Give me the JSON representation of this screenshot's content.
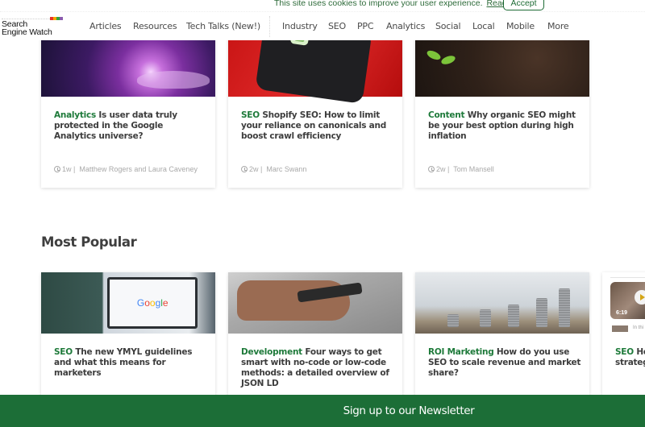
{
  "cookie_bar": {
    "message": "This site uses cookies to improve your user experience.",
    "link_label": "Read More",
    "accept_label": "Accept"
  },
  "header": {
    "logo_line1": "Search",
    "logo_line2": "Engine Watch",
    "logo_colors": [
      "#e6332a",
      "#f7a600",
      "#2fa33f",
      "#8a5cad"
    ],
    "nav_primary": [
      "Articles",
      "Resources",
      "Tech Talks (New!)"
    ],
    "nav_secondary": [
      "Industry",
      "SEO",
      "PPC",
      "Analytics",
      "Social",
      "Local",
      "Mobile",
      "More"
    ]
  },
  "latest_cards": [
    {
      "category": "Analytics",
      "title": "Is user data truly protected in the Google Analytics universe?",
      "age": "1w",
      "author": "Matthew Rogers and Laura Caveney"
    },
    {
      "category": "SEO",
      "title": "Shopify SEO: How to limit your reliance on canonicals and boost crawl efficiency",
      "age": "2w",
      "author": "Marc Swann"
    },
    {
      "category": "Content",
      "title": "Why organic SEO might be your best option during high inflation",
      "age": "2w",
      "author": "Tom Mansell"
    }
  ],
  "most_popular": {
    "heading": "Most Popular",
    "cards": [
      {
        "category": "SEO",
        "title": "The new YMYL guidelines and what this means for marketers",
        "image_text": "Google"
      },
      {
        "category": "Development",
        "title": "Four ways to get smart with no-code or low-code methods: a detailed overview of JSON LD"
      },
      {
        "category": "ROI Marketing",
        "title": "How do you use SEO to scale revenue and market share?"
      },
      {
        "category": "SEO",
        "title": "Ho",
        "title_line2": "strategy",
        "video_time": "6:19",
        "thumb_caption": "In thi"
      }
    ]
  },
  "newsletter": {
    "label": "Sign up to our Newsletter"
  },
  "colors": {
    "brand_green": "#1c6e37",
    "category_green": "#1e7a3a"
  }
}
